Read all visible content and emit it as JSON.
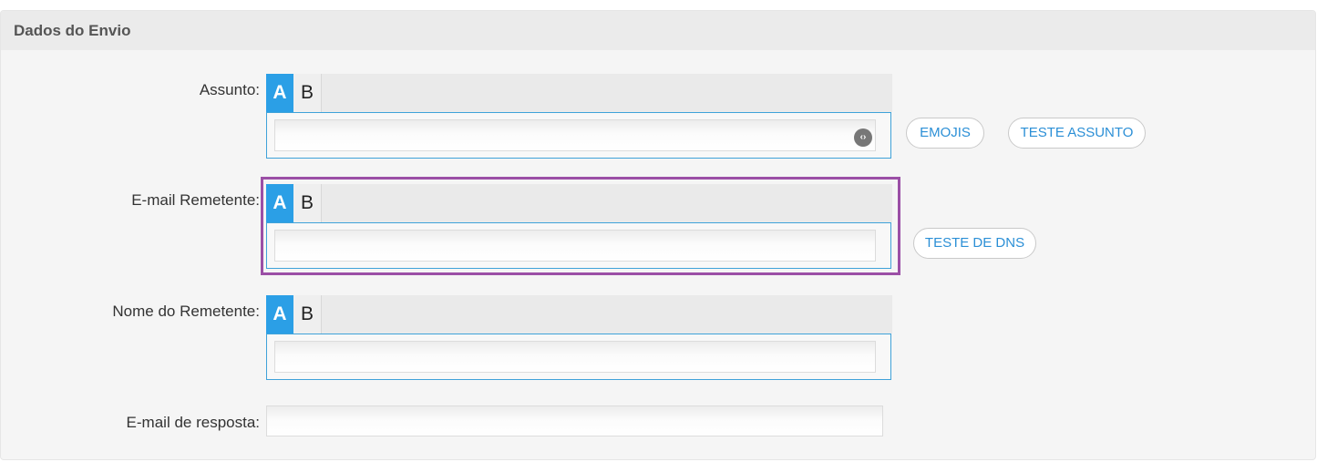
{
  "section_title": "Dados do Envio",
  "fields": {
    "subject": {
      "label": "Assunto:",
      "tab_a": "A",
      "tab_b": "B",
      "value": "",
      "placeholder": "",
      "code_icon_glyph": "‹›",
      "code_icon": "code-icon"
    },
    "sender_email": {
      "label": "E-mail Remetente:",
      "tab_a": "A",
      "tab_b": "B",
      "value": "",
      "placeholder": ""
    },
    "sender_name": {
      "label": "Nome do Remetente:",
      "tab_a": "A",
      "tab_b": "B",
      "value": "",
      "placeholder": ""
    },
    "reply_email": {
      "label": "E-mail de resposta:",
      "value": "",
      "placeholder": ""
    }
  },
  "buttons": {
    "emojis": "EMOJIS",
    "test_subject": "TESTE ASSUNTO",
    "test_dns": "TESTE DE DNS"
  },
  "colors": {
    "accent": "#2b9fe6",
    "highlight": "#9b4fa6",
    "button_text": "#2b8fd6"
  }
}
